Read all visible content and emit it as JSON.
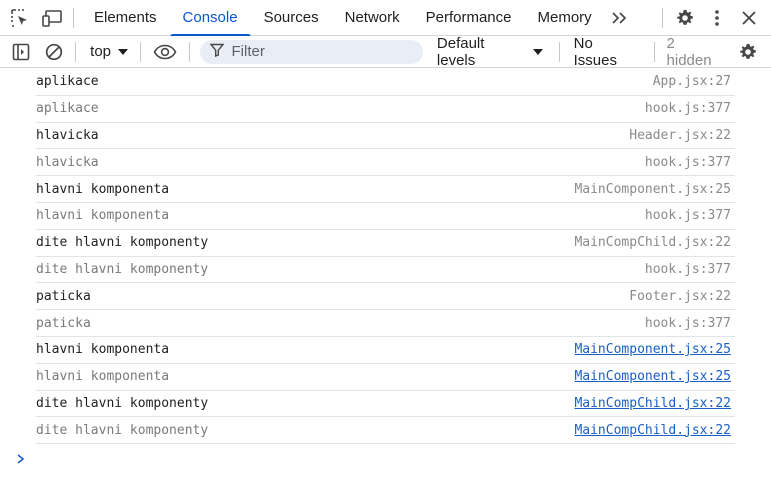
{
  "tabbar": {
    "tabs": [
      {
        "label": "Elements",
        "active": false
      },
      {
        "label": "Console",
        "active": true
      },
      {
        "label": "Sources",
        "active": false
      },
      {
        "label": "Network",
        "active": false
      },
      {
        "label": "Performance",
        "active": false
      },
      {
        "label": "Memory",
        "active": false
      }
    ],
    "icons": [
      "inspect-element-icon",
      "device-toolbar-icon",
      "more-tabs-icon",
      "settings-gear-icon",
      "kebab-menu-icon",
      "close-icon"
    ]
  },
  "toolbar": {
    "context": "top",
    "filter_placeholder": "Filter",
    "levels_label": "Default levels",
    "issues_label": "No Issues",
    "hidden_label": "2 hidden",
    "icons": [
      "show-sidebar-icon",
      "clear-console-icon",
      "live-expression-eye-icon",
      "filter-icon",
      "console-settings-gear-icon"
    ]
  },
  "log": [
    {
      "message": "aplikace",
      "source": "App.jsx:27",
      "dim": false,
      "link": false
    },
    {
      "message": "aplikace",
      "source": "hook.js:377",
      "dim": true,
      "link": false
    },
    {
      "message": "hlavicka",
      "source": "Header.jsx:22",
      "dim": false,
      "link": false
    },
    {
      "message": "hlavicka",
      "source": "hook.js:377",
      "dim": true,
      "link": false
    },
    {
      "message": "hlavni komponenta",
      "source": "MainComponent.jsx:25",
      "dim": false,
      "link": false
    },
    {
      "message": "hlavni komponenta",
      "source": "hook.js:377",
      "dim": true,
      "link": false
    },
    {
      "message": "dite hlavni komponenty",
      "source": "MainCompChild.jsx:22",
      "dim": false,
      "link": false
    },
    {
      "message": "dite hlavni komponenty",
      "source": "hook.js:377",
      "dim": true,
      "link": false
    },
    {
      "message": "paticka",
      "source": "Footer.jsx:22",
      "dim": false,
      "link": false
    },
    {
      "message": "paticka",
      "source": "hook.js:377",
      "dim": true,
      "link": false
    },
    {
      "message": "hlavni komponenta",
      "source": "MainComponent.jsx:25",
      "dim": false,
      "link": true
    },
    {
      "message": "hlavni komponenta",
      "source": "MainComponent.jsx:25",
      "dim": true,
      "link": true
    },
    {
      "message": "dite hlavni komponenty",
      "source": "MainCompChild.jsx:22",
      "dim": false,
      "link": true
    },
    {
      "message": "dite hlavni komponenty",
      "source": "MainCompChild.jsx:22",
      "dim": true,
      "link": true
    }
  ],
  "colors": {
    "accent": "#0b57d0",
    "link": "#1a5fc4",
    "dim_text": "#7a7a7a",
    "filter_bg": "#e9eef6"
  }
}
